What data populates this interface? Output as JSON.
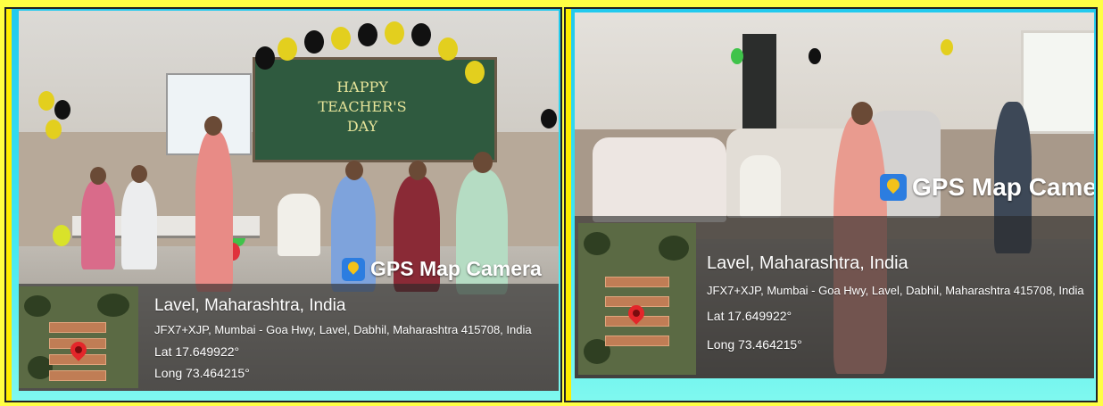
{
  "colors": {
    "outer_frame": "#ffff44",
    "panel_gradient_top": "#22c9ee",
    "panel_gradient_bottom": "#7ff8ef",
    "gps_icon": "#2c7de0",
    "map_pin": "#e3262a"
  },
  "photos": [
    {
      "gps_brand": "GPS Map Camera",
      "brand_icon": "gps-map-camera-icon",
      "place": "Lavel, Maharashtra, India",
      "address": "JFX7+XJP, Mumbai - Goa Hwy, Lavel, Dabhil, Maharashtra 415708, India",
      "lat": "Lat 17.649922°",
      "long": "Long 73.464215°",
      "board_text": "HAPPY TEACHER'S DAY"
    },
    {
      "gps_brand": "GPS Map Camera",
      "brand_icon": "gps-map-camera-icon",
      "place": "Lavel, Maharashtra, India",
      "address": "JFX7+XJP, Mumbai - Goa Hwy, Lavel, Dabhil, Maharashtra 415708, India",
      "lat": "Lat 17.649922°",
      "long": "Long 73.464215°"
    }
  ]
}
